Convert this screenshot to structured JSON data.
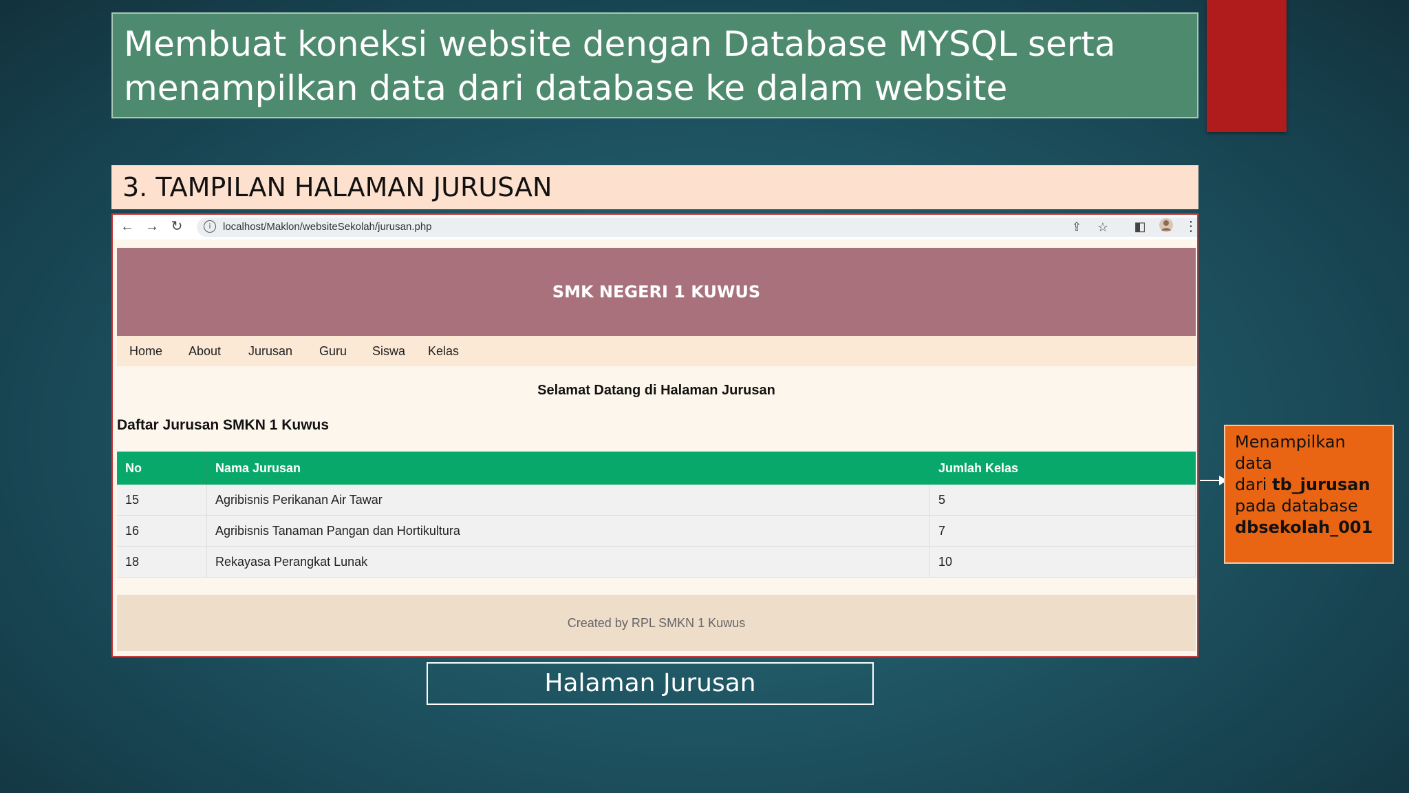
{
  "slide": {
    "title": "Membuat koneksi website dengan Database MYSQL serta menampilkan data dari database ke dalam website",
    "section_header": "3. TAMPILAN HALAMAN JURUSAN",
    "caption": "Halaman Jurusan",
    "accent_colors": {
      "title_bg": "#4e8a6e",
      "red_bar": "#b01c1c",
      "header_bg": "#fde0cd",
      "note_bg": "#e96513"
    }
  },
  "browser": {
    "url": "localhost/Maklon/websiteSekolah/jurusan.php",
    "icons": [
      "back-arrow-icon",
      "forward-arrow-icon",
      "reload-icon",
      "info-icon",
      "share-icon",
      "star-icon",
      "sidepanel-icon",
      "profile-icon",
      "more-vert-icon"
    ]
  },
  "site": {
    "header_title": "SMK NEGERI 1 KUWUS",
    "nav": [
      "Home",
      "About",
      "Jurusan",
      "Guru",
      "Siswa",
      "Kelas"
    ],
    "welcome": "Selamat Datang di Halaman Jurusan",
    "list_title": "Daftar Jurusan SMKN 1 Kuwus",
    "table": {
      "headers": [
        "No",
        "Nama Jurusan",
        "Jumlah Kelas"
      ],
      "rows": [
        [
          "15",
          "Agribisnis Perikanan Air Tawar",
          "5"
        ],
        [
          "16",
          "Agribisnis Tanaman Pangan dan Hortikultura",
          "7"
        ],
        [
          "18",
          "Rekayasa Perangkat Lunak",
          "10"
        ]
      ]
    },
    "footer": "Created by RPL SMKN 1 Kuwus",
    "colors": {
      "header_bg": "#a8717b",
      "nav_bg": "#fbe9d6",
      "table_header": "#08a86a",
      "footer_bg": "#eeddc9"
    }
  },
  "note": {
    "line1": "Menampilkan data",
    "dari": "dari ",
    "table_name": "tb_jurusan",
    "pada": "pada database",
    "db_name": "dbsekolah_001"
  }
}
